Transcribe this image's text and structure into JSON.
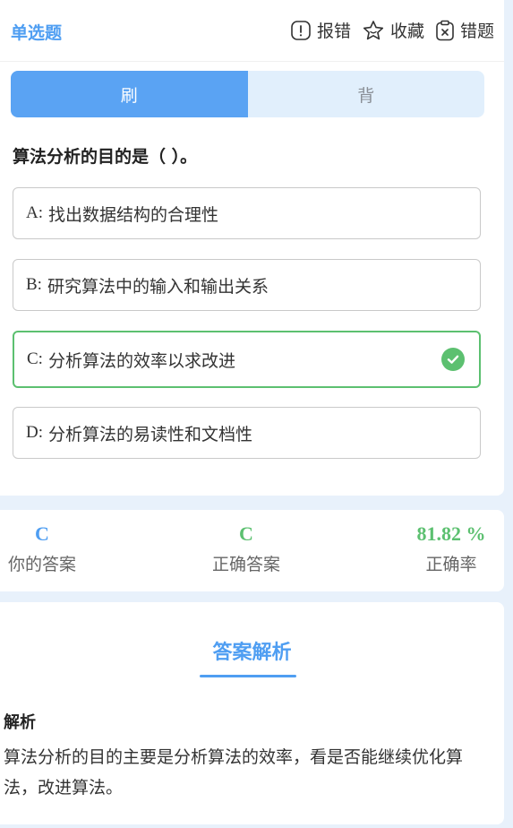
{
  "header": {
    "question_type": "单选题",
    "actions": [
      {
        "label": "报错",
        "icon": "exclamation-icon"
      },
      {
        "label": "收藏",
        "icon": "star-icon"
      },
      {
        "label": "错题",
        "icon": "clipboard-x-icon"
      }
    ]
  },
  "mode_tabs": [
    {
      "label": "刷",
      "active": true
    },
    {
      "label": "背",
      "active": false
    }
  ],
  "question": {
    "text": "算法分析的目的是（ ）。",
    "options": [
      {
        "letter": "A:",
        "text": "找出数据结构的合理性",
        "correct": false
      },
      {
        "letter": "B:",
        "text": "研究算法中的输入和输出关系",
        "correct": false
      },
      {
        "letter": "C:",
        "text": "分析算法的效率以求改进",
        "correct": true
      },
      {
        "letter": "D:",
        "text": "分析算法的易读性和文档性",
        "correct": false
      }
    ]
  },
  "stats": {
    "your_answer": {
      "value": "C",
      "label": "你的答案",
      "color": "#4f9ef2"
    },
    "correct_answer": {
      "value": "C",
      "label": "正确答案",
      "color": "#5cc070"
    },
    "accuracy": {
      "value": "81.82 %",
      "label": "正确率",
      "color": "#5cc070"
    }
  },
  "analysis": {
    "title": "答案解析",
    "heading": "解析",
    "body": "算法分析的目的主要是分析算法的效率，看是否能继续优化算法，改进算法。"
  },
  "colors": {
    "accent": "#4f9ef2",
    "correct": "#5cc070",
    "page_bg": "#e8f1fb"
  }
}
